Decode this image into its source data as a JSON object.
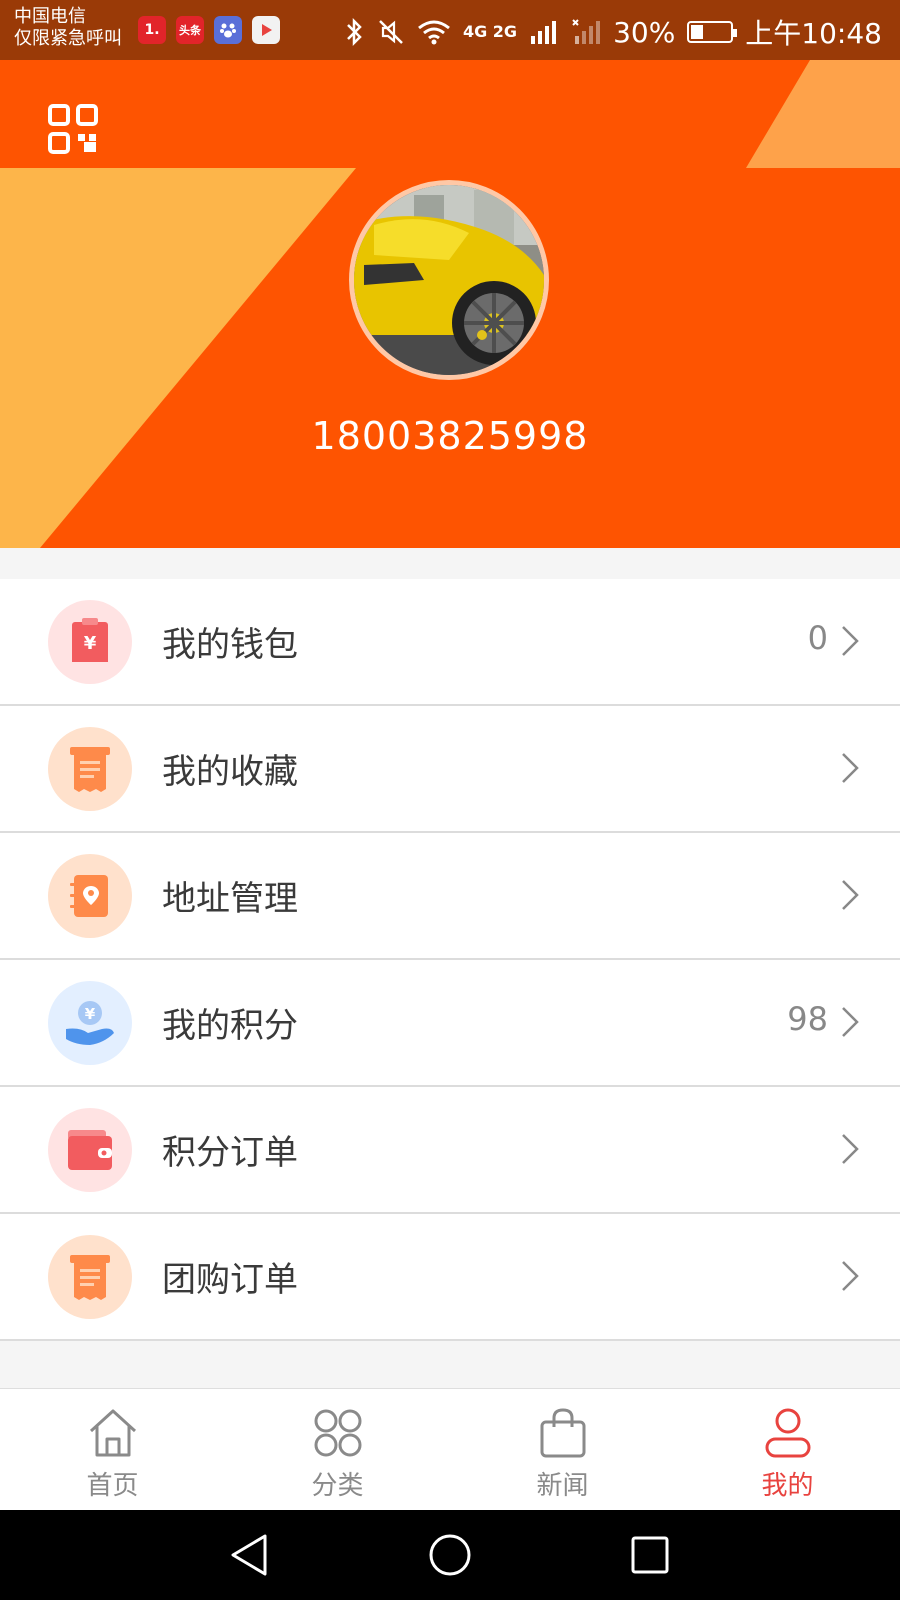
{
  "status_bar": {
    "carrier_line1": "中国电信",
    "carrier_line2": "仅限紧急呼叫",
    "notif_badges": [
      "1.",
      "头条",
      "",
      ""
    ],
    "network_text": "4G 2G",
    "battery_percent": "30%",
    "battery_level": 0.3,
    "time": "上午10:48"
  },
  "profile": {
    "avatar_alt": "avatar",
    "phone": "18003825998"
  },
  "menu": [
    {
      "label": "我的钱包",
      "value": "0",
      "icon": "wallet-receipt-icon",
      "icon_bg": "#ffe3e3",
      "icon_color": "#f25c5f"
    },
    {
      "label": "我的收藏",
      "value": "",
      "icon": "receipt-icon",
      "icon_bg": "#ffe1cc",
      "icon_color": "#fe8a4a"
    },
    {
      "label": "地址管理",
      "value": "",
      "icon": "address-book-icon",
      "icon_bg": "#ffe1cc",
      "icon_color": "#fe8a4a"
    },
    {
      "label": "我的积分",
      "value": "98",
      "icon": "coin-hand-icon",
      "icon_bg": "#e3efff",
      "icon_color": "#4f94ec"
    },
    {
      "label": "积分订单",
      "value": "",
      "icon": "wallet-icon",
      "icon_bg": "#ffe3e3",
      "icon_color": "#f25c5f"
    },
    {
      "label": "团购订单",
      "value": "",
      "icon": "receipt-icon",
      "icon_bg": "#ffe1cc",
      "icon_color": "#fe8a4a"
    }
  ],
  "bottom_nav": [
    {
      "label": "首页",
      "icon": "home-icon",
      "active": false
    },
    {
      "label": "分类",
      "icon": "category-icon",
      "active": false
    },
    {
      "label": "新闻",
      "icon": "bag-icon",
      "active": false
    },
    {
      "label": "我的",
      "icon": "user-icon",
      "active": true
    }
  ],
  "colors": {
    "header_orange": "#fe5401",
    "accent_yellow": "#fdb54a",
    "active_red": "#e8433f"
  }
}
